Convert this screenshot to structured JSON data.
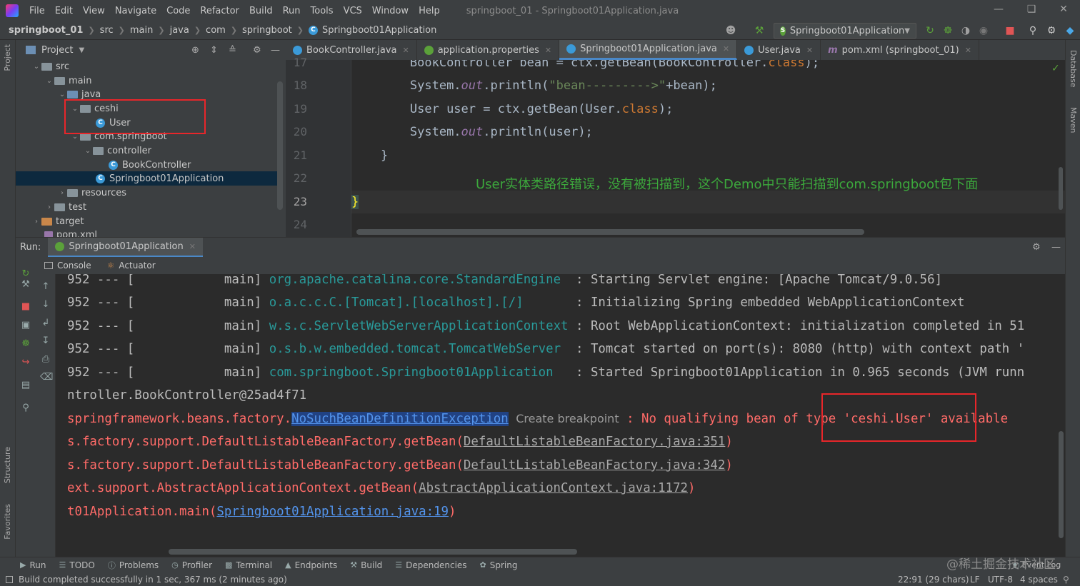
{
  "menubar": {
    "items": [
      "File",
      "Edit",
      "View",
      "Navigate",
      "Code",
      "Refactor",
      "Build",
      "Run",
      "Tools",
      "VCS",
      "Window",
      "Help"
    ],
    "window_title": "springboot_01 - Springboot01Application.java"
  },
  "navbar": {
    "crumbs": [
      "springboot_01",
      "src",
      "main",
      "java",
      "com",
      "springboot",
      "Springboot01Application"
    ],
    "run_config": "Springboot01Application"
  },
  "left_stripe": {
    "project": "Project",
    "structure": "Structure",
    "favorites": "Favorites"
  },
  "right_stripe": {
    "database": "Database",
    "maven": "Maven"
  },
  "project_panel": {
    "title": "Project",
    "tree": [
      {
        "label": "src",
        "type": "folder"
      },
      {
        "label": "main",
        "type": "folder"
      },
      {
        "label": "java",
        "type": "folder-blue"
      },
      {
        "label": "ceshi",
        "type": "package"
      },
      {
        "label": "User",
        "type": "class"
      },
      {
        "label": "com.springboot",
        "type": "package"
      },
      {
        "label": "controller",
        "type": "package"
      },
      {
        "label": "BookController",
        "type": "class"
      },
      {
        "label": "Springboot01Application",
        "type": "class"
      },
      {
        "label": "resources",
        "type": "folder"
      },
      {
        "label": "test",
        "type": "folder"
      },
      {
        "label": "target",
        "type": "folder-orange"
      },
      {
        "label": "pom.xml",
        "type": "file"
      }
    ]
  },
  "editor_tabs": [
    {
      "label": "BookController.java"
    },
    {
      "label": "application.properties"
    },
    {
      "label": "Springboot01Application.java"
    },
    {
      "label": "User.java"
    },
    {
      "label": "pom.xml (springboot_01)"
    }
  ],
  "editor": {
    "line_numbers": [
      "17",
      "18",
      "19",
      "20",
      "21",
      "22",
      "23",
      "24"
    ],
    "lines": [
      {
        "indent": "        ",
        "t1": "BookController bean = ctx.getBean(BookController.",
        "kw": "class",
        "t2": ");"
      },
      {
        "indent": "        ",
        "t1": "System.",
        "it": "out",
        "t2": ".println(",
        "str": "\"bean--------->\"",
        "t3": "+bean);"
      },
      {
        "indent": "        ",
        "t1": "User user = ctx.getBean(User.",
        "kw": "class",
        "t2": ");"
      },
      {
        "indent": "        ",
        "t1": "System.",
        "it": "out",
        "t2": ".println(user);"
      },
      {
        "indent": "    ",
        "t1": "}"
      },
      {
        "indent": "",
        "t1": ""
      },
      {
        "indent": "",
        "t1": "}"
      },
      {
        "indent": "",
        "t1": ""
      }
    ],
    "annotation": "User实体类路径错误，没有被扫描到，这个Demo中只能扫描到com.springboot包下面"
  },
  "run_panel": {
    "label": "Run:",
    "tab": "Springboot01Application",
    "subtabs": [
      "Console",
      "Actuator"
    ]
  },
  "console": {
    "log_lines": [
      {
        "pid": "952 --- [",
        "thread": "main]",
        "logger": "org.apache.catalina.core.StandardEngine ",
        "msg": ": Starting Servlet engine: [Apache Tomcat/9.0.56]"
      },
      {
        "pid": "952 --- [",
        "thread": "main]",
        "logger": "o.a.c.c.C.[Tomcat].[localhost].[/]      ",
        "msg": ": Initializing Spring embedded WebApplicationContext"
      },
      {
        "pid": "952 --- [",
        "thread": "main]",
        "logger": "w.s.c.ServletWebServerApplicationContext",
        "msg": ": Root WebApplicationContext: initialization completed in 51"
      },
      {
        "pid": "952 --- [",
        "thread": "main]",
        "logger": "o.s.b.w.embedded.tomcat.TomcatWebServer ",
        "msg": ": Tomcat started on port(s): 8080 (http) with context path '"
      },
      {
        "pid": "952 --- [",
        "thread": "main]",
        "logger": "com.springboot.Springboot01Application  ",
        "msg": ": Started Springboot01Application in 0.965 seconds (JVM runn"
      }
    ],
    "bean_line": "ntroller.BookController@25ad4f71",
    "exception": {
      "prefix": "springframework.beans.factory.",
      "class": "NoSuchBeanDefinitionException",
      "hint": "Create breakpoint",
      "message": ": No qualifying bean of type 'ceshi.User' available"
    },
    "stack": [
      {
        "method": "s.factory.support.DefaultListableBeanFactory.getBean(",
        "loc": "DefaultListableBeanFactory.java:351",
        "end": ")"
      },
      {
        "method": "s.factory.support.DefaultListableBeanFactory.getBean(",
        "loc": "DefaultListableBeanFactory.java:342",
        "end": ")"
      },
      {
        "method": "ext.support.AbstractApplicationContext.getBean(",
        "loc": "AbstractApplicationContext.java:1172",
        "end": ")"
      },
      {
        "method": "t01Application.main(",
        "loc": "Springboot01Application.java:19",
        "end": ")"
      }
    ]
  },
  "bottom_tools": [
    "Run",
    "TODO",
    "Problems",
    "Profiler",
    "Terminal",
    "Endpoints",
    "Build",
    "Dependencies",
    "Spring"
  ],
  "status": {
    "message": "Build completed successfully in 1 sec, 367 ms (2 minutes ago)",
    "position": "22:91 (29 chars)",
    "line_sep": "LF",
    "encoding": "UTF-8",
    "indent": "4 spaces"
  },
  "watermark": "@稀土掘金技术社区",
  "event_log": "Event Log",
  "colors": {
    "accent": "#4a88c7",
    "error": "#ff6b68",
    "annotation": "#3ca83c",
    "highlight_box": "#e8262a"
  }
}
